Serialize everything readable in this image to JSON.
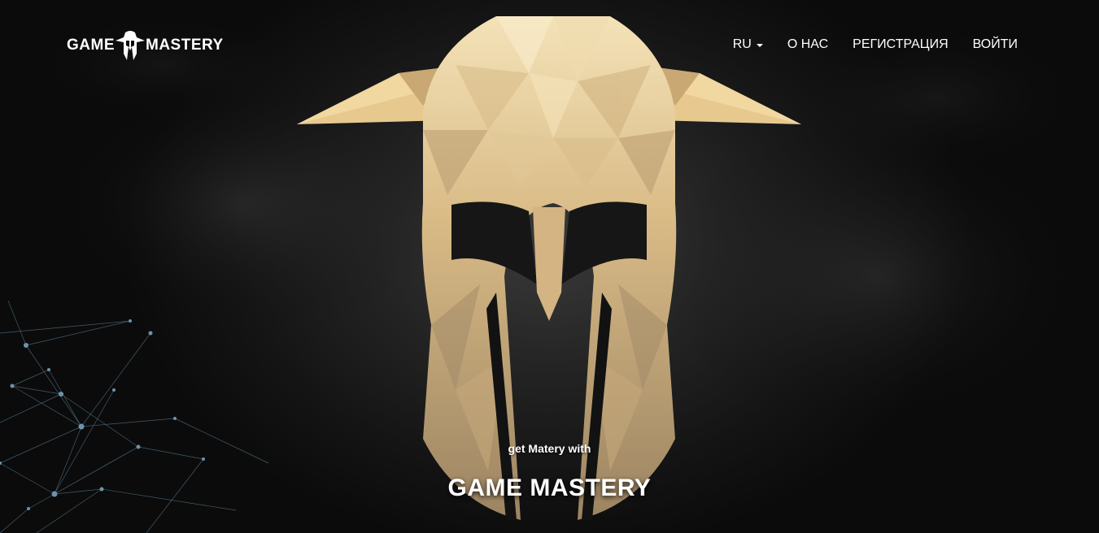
{
  "logo": {
    "left_text": "GAME",
    "right_text": "MASTERY",
    "emblem_icon": "spartan-helmet-icon"
  },
  "nav": {
    "language": "RU",
    "about": "О НАС",
    "register": "РЕГИСТРАЦИЯ",
    "login": "ВОЙТИ"
  },
  "hero": {
    "subtitle": "get Matery with",
    "title": "GAME MASTERY",
    "image_icon": "spartan-helmet-icon"
  },
  "colors": {
    "background": "#141414",
    "text": "#ffffff",
    "helmet_gold": "#d8b98a",
    "network": "#5a7d95"
  }
}
